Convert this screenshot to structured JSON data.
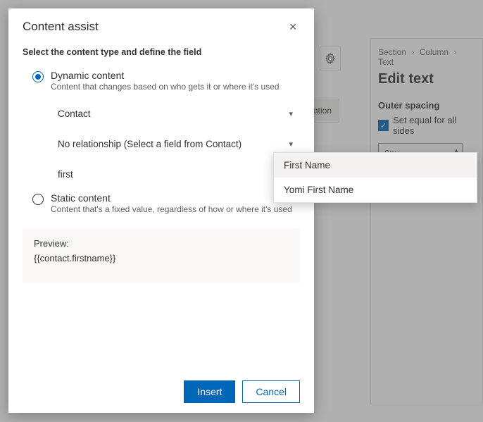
{
  "modal": {
    "title": "Content assist",
    "instruction": "Select the content type and define the field",
    "options": {
      "dynamic": {
        "label": "Dynamic content",
        "desc": "Content that changes based on who gets it or where it's used"
      },
      "static": {
        "label": "Static content",
        "desc": "Content that's a fixed value, regardless of how or where it's used"
      }
    },
    "fields": {
      "entity": "Contact",
      "relationship": "No relationship (Select a field from Contact)",
      "search_value": "first"
    },
    "preview": {
      "label": "Preview:",
      "value": "{{contact.firstname}}"
    },
    "buttons": {
      "insert": "Insert",
      "cancel": "Cancel"
    }
  },
  "autocomplete": {
    "items": [
      "First Name",
      "Yomi First Name"
    ]
  },
  "right_panel": {
    "breadcrumb": [
      "Section",
      "Column",
      "Text"
    ],
    "title": "Edit text",
    "section": "Outer spacing",
    "checkbox_label": "Set equal for all sides",
    "spacing_value": "0px"
  },
  "behind": {
    "tab_fragment": "zation"
  }
}
